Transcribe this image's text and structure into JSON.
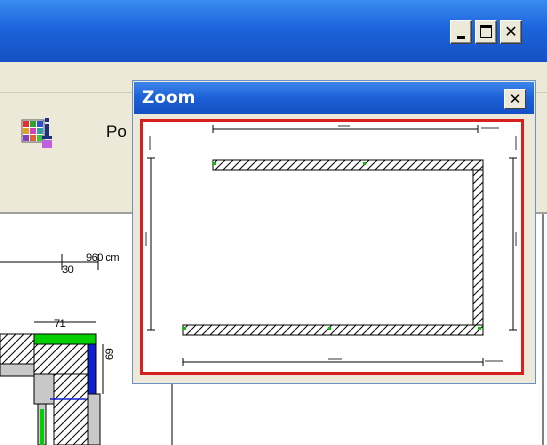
{
  "main_window": {
    "controls": {
      "minimize_icon": "minimize-icon",
      "maximize_icon": "maximize-icon",
      "close_glyph": "✕"
    },
    "title_bar_color": "#1d64db"
  },
  "toolbar": {
    "properties_icon": "grid-info-icon",
    "partial_label": "Po"
  },
  "drawing": {
    "dim_total": "960 cm",
    "dim_small": "30",
    "dim_top_wall": "71",
    "dim_side_wall": "69"
  },
  "zoom_window": {
    "title": "Zoom",
    "close_glyph": "✕",
    "frame_color": "#d62020"
  }
}
